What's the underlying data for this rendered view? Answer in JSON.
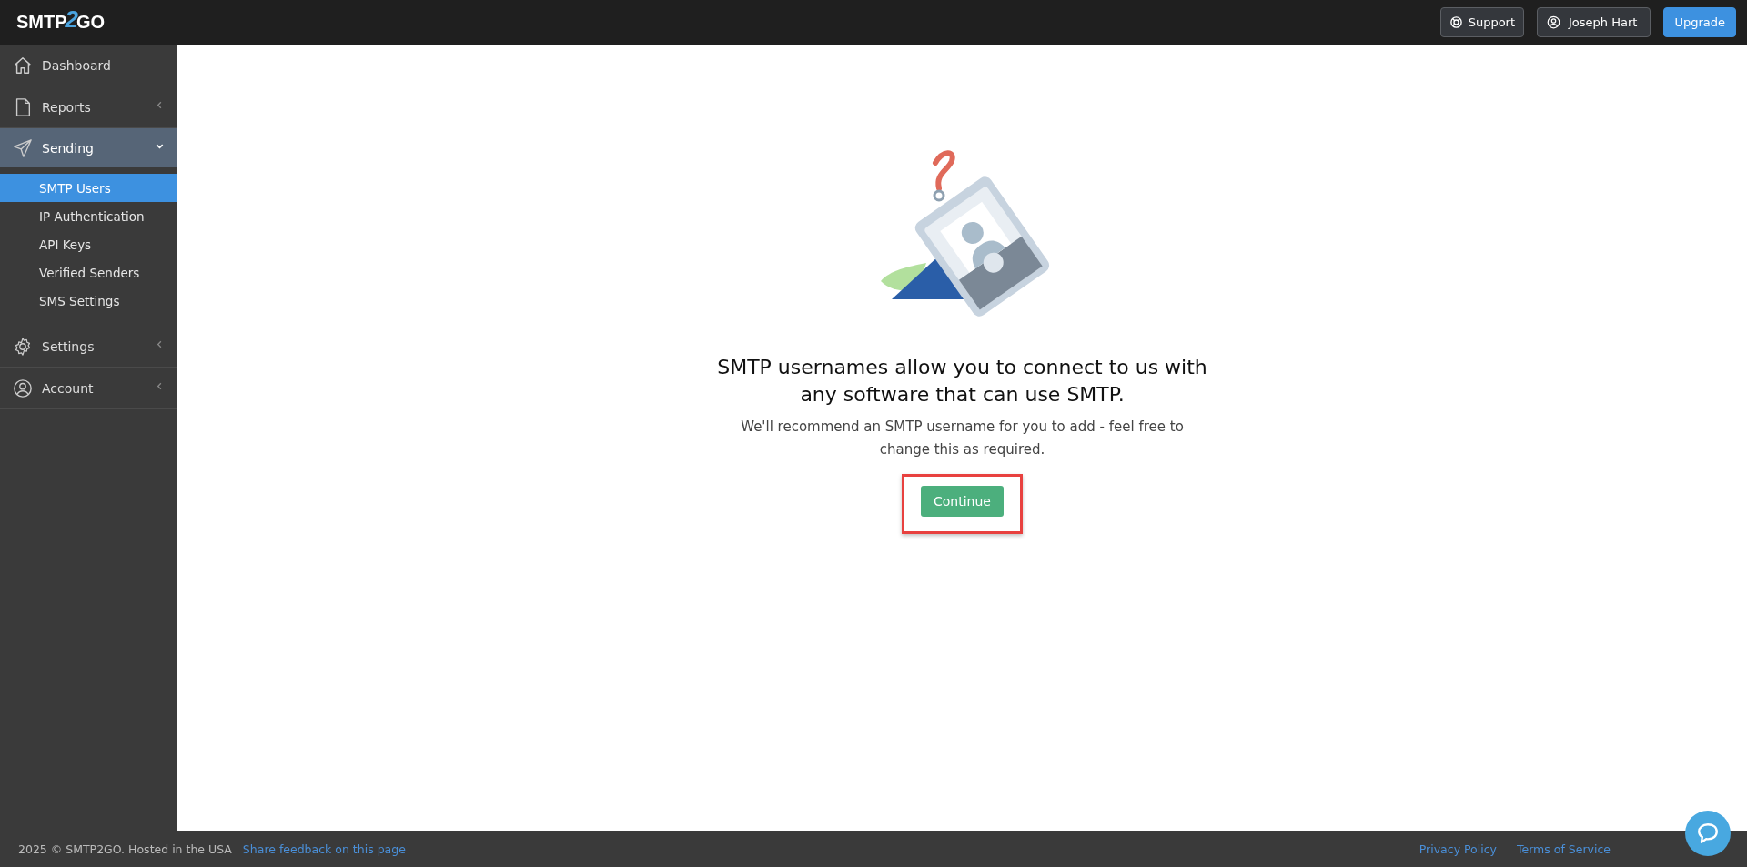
{
  "header": {
    "logo": [
      "SMTP",
      "2",
      "GO"
    ],
    "buttons": [
      {
        "kind": "support",
        "label": "Support"
      },
      {
        "kind": "user",
        "label": "Joseph Hart"
      },
      {
        "kind": "primary",
        "label": "Upgrade"
      }
    ]
  },
  "sidebar": {
    "items": [
      {
        "label": "Dashboard",
        "kind": "home",
        "expanded": false,
        "has_children": false
      },
      {
        "label": "Reports",
        "kind": "file",
        "expanded": false,
        "has_children": true
      },
      {
        "label": "Sending",
        "kind": "send",
        "expanded": true,
        "has_children": true,
        "children": [
          {
            "label": "SMTP Users",
            "selected": true
          },
          {
            "label": "IP Authentication",
            "selected": false
          },
          {
            "label": "API Keys",
            "selected": false
          },
          {
            "label": "Verified Senders",
            "selected": false
          },
          {
            "label": "SMS Settings",
            "selected": false
          }
        ]
      },
      {
        "label": "Settings",
        "kind": "gear",
        "expanded": false,
        "has_children": true
      },
      {
        "label": "Account",
        "kind": "user",
        "expanded": false,
        "has_children": true
      }
    ]
  },
  "main": {
    "heading": "SMTP usernames allow you to connect to us with any software that can use SMTP.",
    "description": "We'll recommend an SMTP username for you to add - feel free to change this as required.",
    "button": {
      "label": "Continue",
      "highlighted": true
    }
  },
  "footer": {
    "copyright": "2025 © SMTP2GO. Hosted in the USA",
    "feedback_link": "Share feedback on this page",
    "links": [
      "Privacy Policy",
      "Terms of Service"
    ]
  }
}
